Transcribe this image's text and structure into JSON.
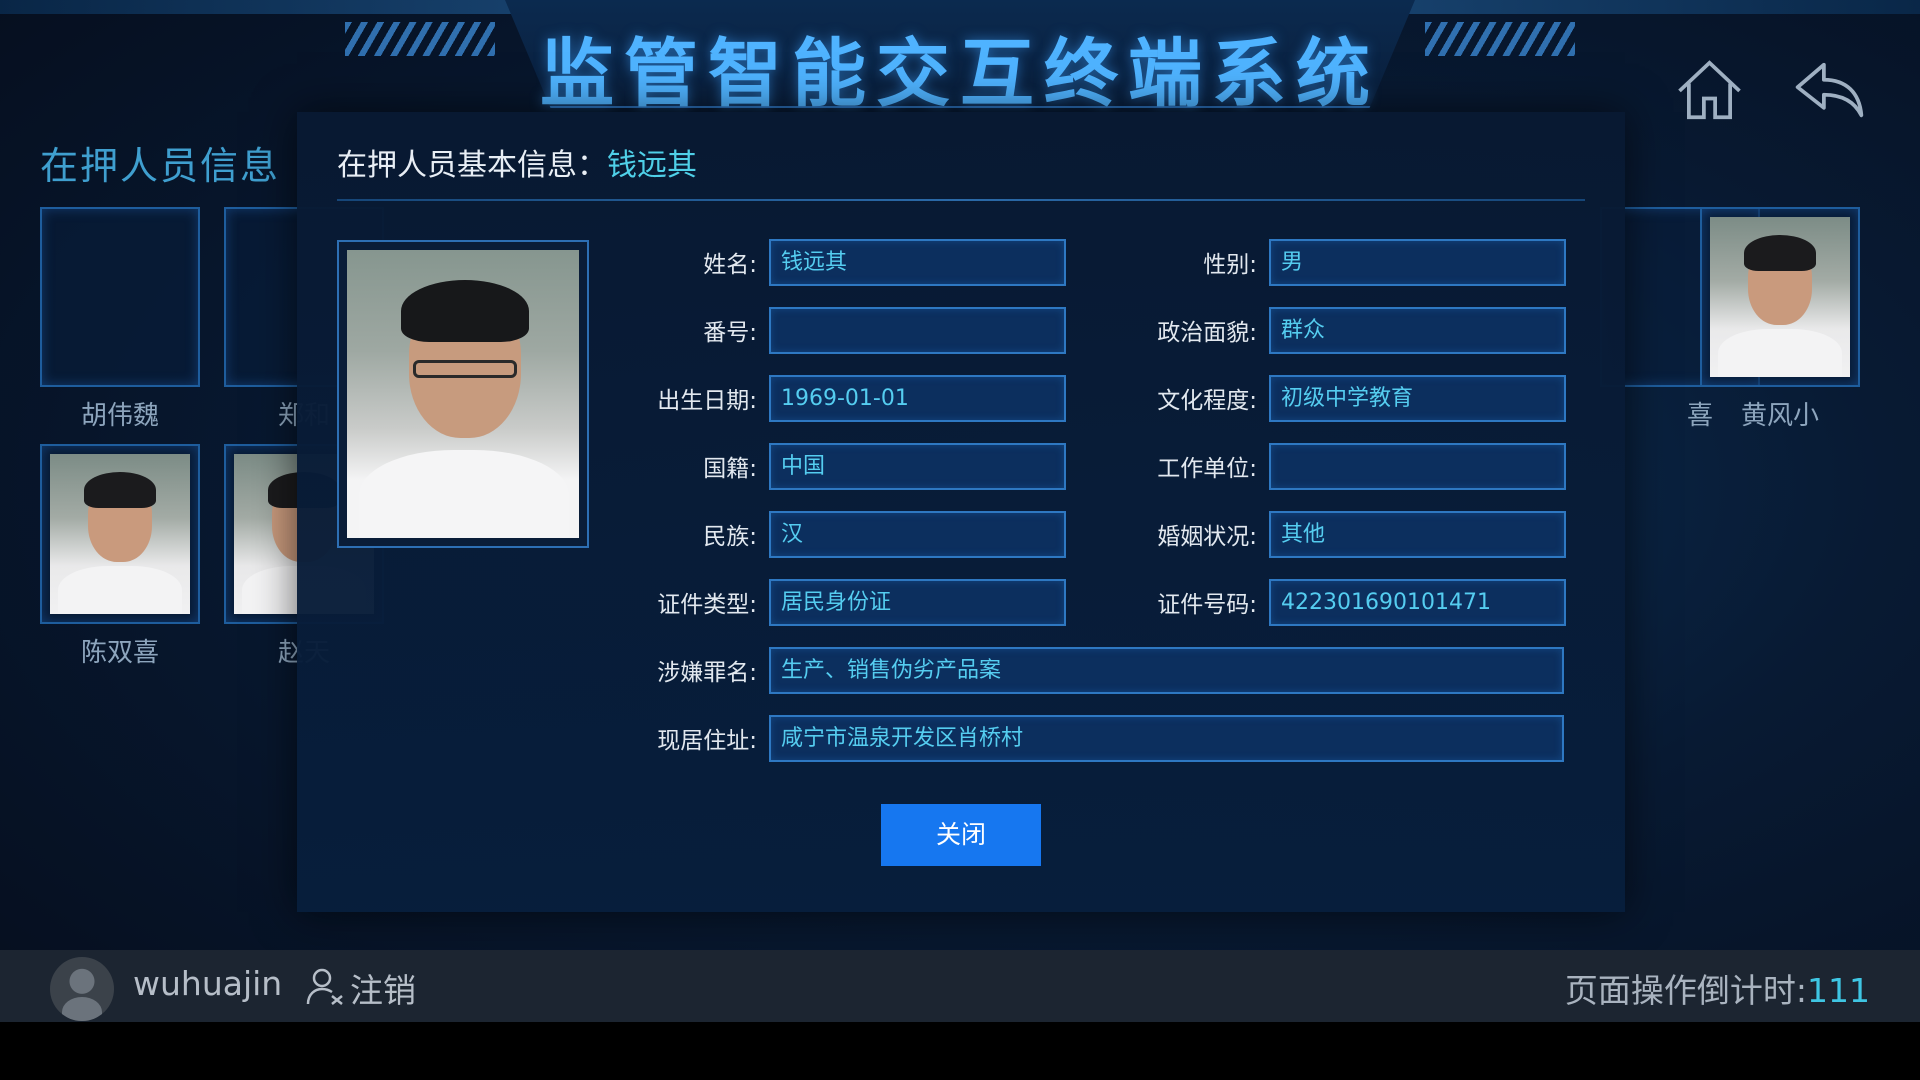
{
  "header": {
    "title": "监管智能交互终端系统"
  },
  "background_page": {
    "section_title": "在押人员信息",
    "persons": [
      {
        "name": "胡伟魏",
        "has_photo": false
      },
      {
        "name": "郑和",
        "has_photo": false
      },
      {
        "name": "陈双喜",
        "has_photo": true
      },
      {
        "name": "赵天",
        "has_photo": true
      },
      {
        "name": "黄风小",
        "has_photo": true
      }
    ],
    "partial_right_label": "喜"
  },
  "modal": {
    "title_prefix": "在押人员基本信息：",
    "title_name": "钱远其",
    "fields": {
      "name": {
        "label": "姓名:",
        "value": "钱远其"
      },
      "gender": {
        "label": "性别:",
        "value": "男"
      },
      "number": {
        "label": "番号:",
        "value": ""
      },
      "political_status": {
        "label": "政治面貌:",
        "value": "群众"
      },
      "birth_date": {
        "label": "出生日期:",
        "value": "1969-01-01"
      },
      "education": {
        "label": "文化程度:",
        "value": "初级中学教育"
      },
      "nationality": {
        "label": "国籍:",
        "value": "中国"
      },
      "work_unit": {
        "label": "工作单位:",
        "value": ""
      },
      "ethnicity": {
        "label": "民族:",
        "value": "汉"
      },
      "marital_status": {
        "label": "婚姻状况:",
        "value": "其他"
      },
      "id_type": {
        "label": "证件类型:",
        "value": "居民身份证"
      },
      "id_number": {
        "label": "证件号码:",
        "value": "422301690101471"
      },
      "charge": {
        "label": "涉嫌罪名:",
        "value": "生产、销售伪劣产品案"
      },
      "address": {
        "label": "现居住址:",
        "value": "咸宁市温泉开发区肖桥村"
      }
    },
    "close_label": "关闭"
  },
  "footer": {
    "username": "wuhuajin",
    "logout_label": "注销",
    "countdown_label": "页面操作倒计时:",
    "countdown_value": "111"
  },
  "colors": {
    "accent_cyan": "#4fd0e8",
    "title_blue": "#4fb3ff",
    "button_blue": "#1677f0"
  }
}
